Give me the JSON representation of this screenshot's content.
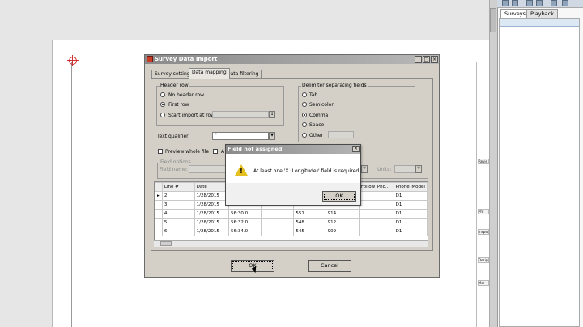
{
  "right_panel": {
    "tabs": [
      {
        "label": "Surveys"
      },
      {
        "label": "Playback"
      }
    ],
    "side_labels": [
      "Revie",
      "Pro",
      "Inspec",
      "Design",
      "Mar ne"
    ]
  },
  "dialog": {
    "title": "Survey Data Import",
    "tabs": [
      {
        "label": "Survey settings"
      },
      {
        "label": "Data mapping"
      },
      {
        "label": "Data filtering"
      }
    ],
    "header_row": {
      "title": "Header row",
      "options": [
        {
          "label": "No header row"
        },
        {
          "label": "First row"
        },
        {
          "label": "Start import at row:"
        }
      ]
    },
    "delimiter": {
      "title": "Delimiter separating fields",
      "options": [
        {
          "label": "Tab"
        },
        {
          "label": "Semicolon"
        },
        {
          "label": "Comma"
        },
        {
          "label": "Space"
        },
        {
          "label": "Other"
        }
      ]
    },
    "text_qualifier": {
      "label": "Text qualifier:",
      "value": "\""
    },
    "preview_whole_file": "Preview whole file",
    "second_checkbox_label": "A",
    "field_options": {
      "title": "Field options",
      "field_name_label": "Field name:",
      "units_label": "Units:"
    },
    "grid": {
      "columns": [
        "Line #",
        "Date",
        "",
        "",
        "",
        "",
        "Follow_Pho...",
        "Phone_Model"
      ],
      "rows": [
        [
          "2",
          "1/28/2015",
          "",
          "",
          "",
          "",
          "",
          "D1"
        ],
        [
          "3",
          "1/28/2015",
          "",
          "",
          "",
          "",
          "",
          "D1"
        ],
        [
          "4",
          "1/28/2015",
          "56:30.0",
          "",
          "551",
          "914",
          "",
          "D1"
        ],
        [
          "5",
          "1/28/2015",
          "56:32.0",
          "",
          "548",
          "912",
          "",
          "D1"
        ],
        [
          "6",
          "1/28/2015",
          "56:34.0",
          "",
          "545",
          "909",
          "",
          "D1"
        ]
      ]
    },
    "ok_label": "OK",
    "cancel_label": "Cancel"
  },
  "popup": {
    "title": "Field not assigned",
    "message": "At least one 'X (Longitude)' field is required.",
    "ok_label": "OK"
  }
}
